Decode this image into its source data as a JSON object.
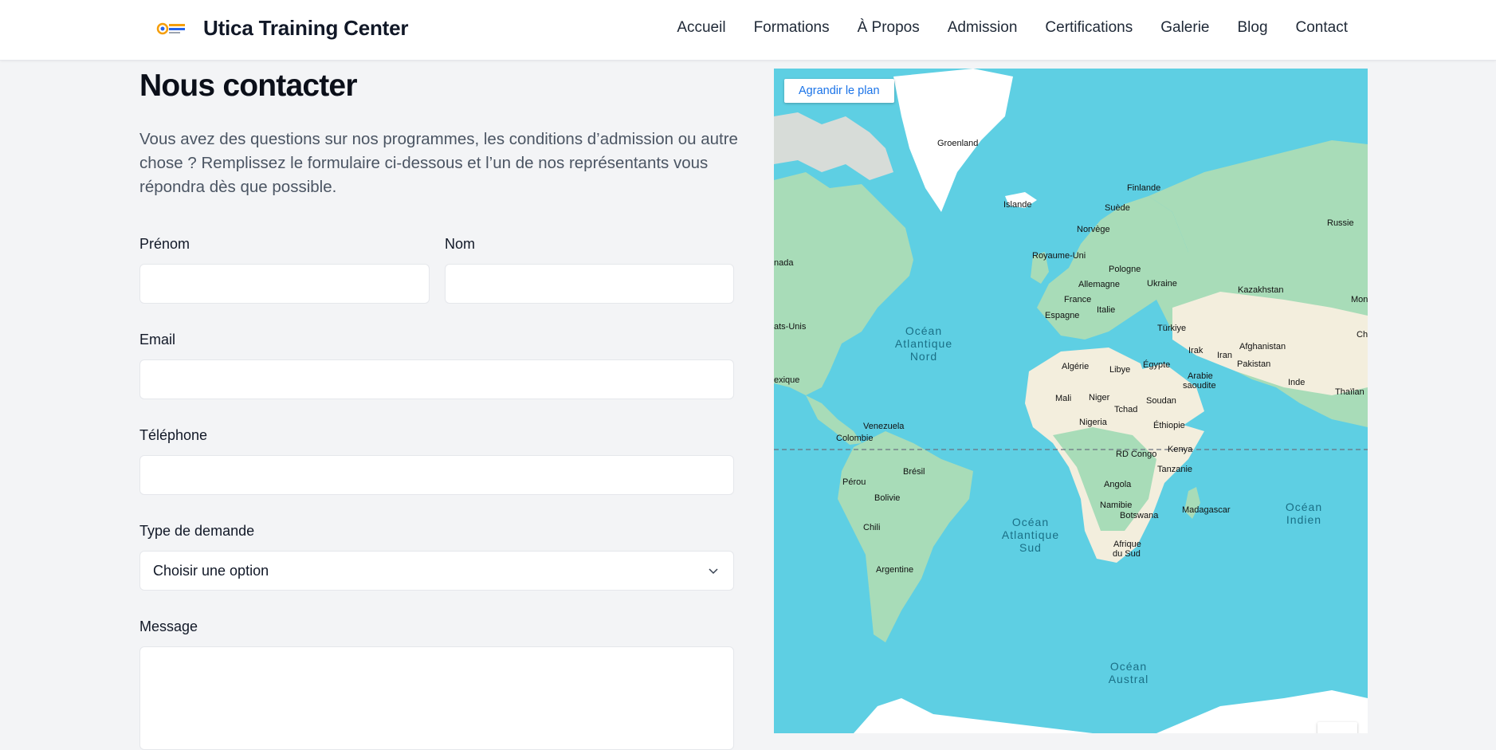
{
  "header": {
    "brand": "Utica Training Center",
    "nav": [
      "Accueil",
      "Formations",
      "À Propos",
      "Admission",
      "Certifications",
      "Galerie",
      "Blog",
      "Contact"
    ]
  },
  "contact": {
    "title": "Nous contacter",
    "intro": "Vous avez des questions sur nos programmes, les conditions d’admission ou autre chose ? Remplissez le formulaire ci-dessous et l’un de nos représentants vous répondra dès que possible.",
    "first_name_label": "Prénom",
    "first_name_value": "",
    "last_name_label": "Nom",
    "last_name_value": "",
    "email_label": "Email",
    "email_value": "",
    "phone_label": "Téléphone",
    "phone_value": "",
    "request_type_label": "Type de demande",
    "request_type_selected": "Choisir une option",
    "message_label": "Message",
    "message_value": ""
  },
  "map": {
    "enlarge_label": "Agrandir le plan",
    "countries": {
      "greenland": "Groenland",
      "iceland": "Islande",
      "finland": "Finlande",
      "sweden": "Suède",
      "norway": "Norvège",
      "russia": "Russie",
      "uk": "Royaume-Uni",
      "poland": "Pologne",
      "germany": "Allemagne",
      "ukraine": "Ukraine",
      "kazakhstan": "Kazakhstan",
      "mongolia": "Mong",
      "france": "France",
      "spain": "Espagne",
      "italy": "Italie",
      "turkey": "Türkiye",
      "china": "Chi",
      "canada": "nada",
      "usa": "ats-Unis",
      "mexico": "exique",
      "algeria": "Algérie",
      "libya": "Libye",
      "egypt": "Égypte",
      "iraq": "Irak",
      "iran": "Iran",
      "afghanistan": "Afghanistan",
      "pakistan": "Pakistan",
      "saudi1": "Arabie",
      "saudi2": "saoudite",
      "india": "Inde",
      "thailand": "Thaïlan",
      "mali": "Mali",
      "niger": "Niger",
      "sudan": "Soudan",
      "chad": "Tchad",
      "nigeria": "Nigeria",
      "ethiopia": "Éthiopie",
      "venezuela": "Venezuela",
      "colombia": "Colombie",
      "kenya": "Kenya",
      "drc": "RD Congo",
      "tanzania": "Tanzanie",
      "brazil": "Brésil",
      "peru": "Pérou",
      "bolivia": "Bolivie",
      "angola": "Angola",
      "namibia": "Namibie",
      "botswana": "Botswana",
      "madagascar": "Madagascar",
      "chile": "Chili",
      "southafrica1": "Afrique",
      "southafrica2": "du Sud",
      "argentina": "Argentine"
    },
    "oceans": {
      "north_atlantic": [
        "Océan",
        "Atlantique",
        "Nord"
      ],
      "south_atlantic": [
        "Océan",
        "Atlantique",
        "Sud"
      ],
      "indian": [
        "Océan",
        "Indien"
      ],
      "southern": [
        "Océan",
        "Austral"
      ]
    }
  },
  "colors": {
    "page_bg": "#f3f4f6",
    "ocean": "#5ecfe3",
    "land_green": "#a8dcb8",
    "land_beige": "#f3eedd",
    "ice": "#ffffff",
    "link_blue": "#1a73e8"
  }
}
